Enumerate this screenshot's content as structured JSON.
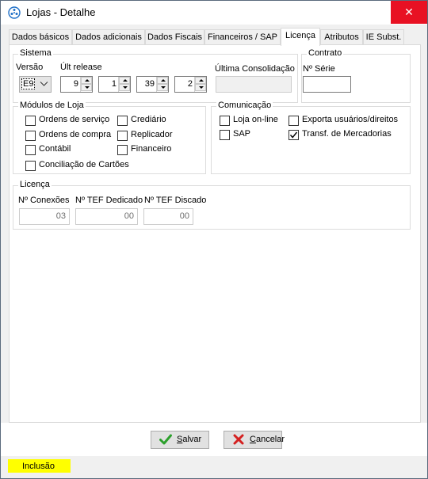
{
  "window": {
    "title": "Lojas - Detalhe",
    "close_glyph": "✕"
  },
  "tabs": [
    {
      "label": "Dados básicos"
    },
    {
      "label": "Dados adicionais"
    },
    {
      "label": "Dados Fiscais"
    },
    {
      "label": "Financeiros / SAP"
    },
    {
      "label": "Licença"
    },
    {
      "label": "Atributos"
    },
    {
      "label": "IE Subst."
    }
  ],
  "sistema": {
    "title": "Sistema",
    "versao_label": "Versão",
    "versao_value": "E9",
    "release_label": "Últ release",
    "release_parts": [
      "9",
      "1",
      "39",
      "2"
    ],
    "consolidacao_label": "Última Consolidação",
    "consolidacao_value": ""
  },
  "contrato": {
    "title": "Contrato",
    "serie_label": "Nº Série",
    "serie_value": ""
  },
  "modulos": {
    "title": "Módulos de Loja",
    "items": [
      {
        "label": "Ordens de serviço",
        "checked": false
      },
      {
        "label": "Ordens de compra",
        "checked": false
      },
      {
        "label": "Contábil",
        "checked": false
      },
      {
        "label": "Conciliação de Cartões",
        "checked": false
      },
      {
        "label": "Crediário",
        "checked": false
      },
      {
        "label": "Replicador",
        "checked": false
      },
      {
        "label": "Financeiro",
        "checked": false
      }
    ]
  },
  "comunicacao": {
    "title": "Comunicação",
    "items": [
      {
        "label": "Loja on-line",
        "checked": false
      },
      {
        "label": "SAP",
        "checked": false
      },
      {
        "label": "Exporta usuários/direitos",
        "checked": false
      },
      {
        "label": "Transf. de Mercadorias",
        "checked": true
      }
    ]
  },
  "licenca": {
    "title": "Licença",
    "conexoes_label": "Nº Conexões",
    "conexoes_value": "03",
    "tef_dedicado_label": "Nº TEF Dedicado",
    "tef_dedicado_value": "00",
    "tef_discado_label": "Nº TEF Discado",
    "tef_discado_value": "00"
  },
  "buttons": {
    "save_label": "Salvar",
    "cancel_label": "Cancelar"
  },
  "status": {
    "mode": "Inclusão"
  },
  "colors": {
    "close_bg": "#e81123",
    "status_highlight": "#ffff00",
    "save_icon": "#2ca02c",
    "cancel_icon": "#d42020"
  }
}
